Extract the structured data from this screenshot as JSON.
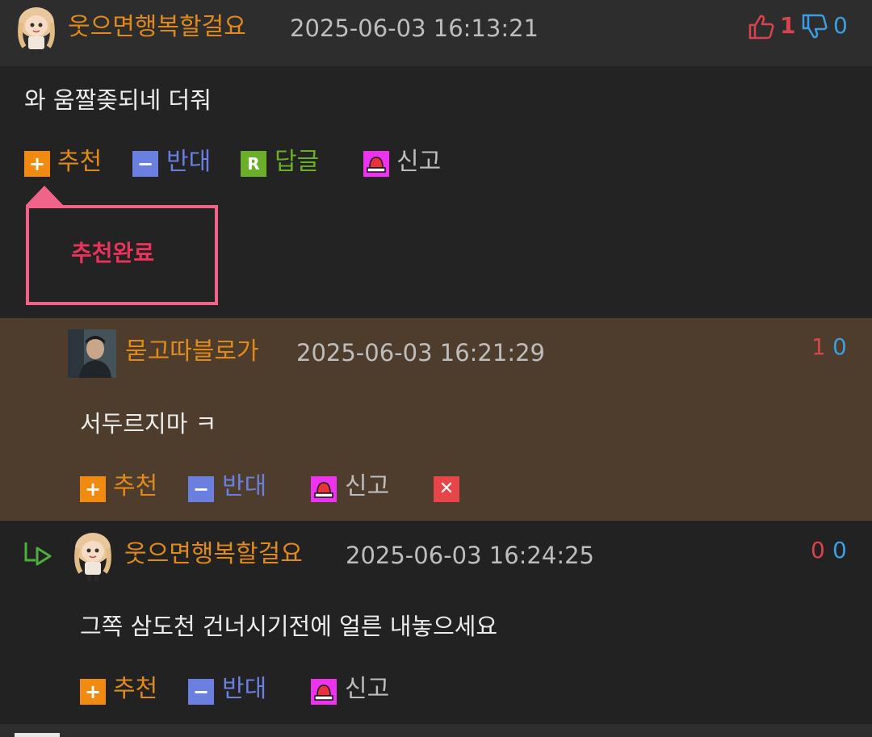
{
  "main_comment": {
    "nickname": "웃으면행복할걸요",
    "datetime": "2025-06-03 16:13:21",
    "like_count": "1",
    "dislike_count": "0",
    "content": "와 움짤좆되네 더줘",
    "actions": {
      "recommend": "추천",
      "oppose": "반대",
      "reply": "답글",
      "report": "신고",
      "reply_icon_letter": "R"
    },
    "popup_text": "추천완료"
  },
  "replies": [
    {
      "nickname": "묻고따블로가",
      "datetime": "2025-06-03 16:21:29",
      "like_count": "1",
      "dislike_count": "0",
      "content": "서두르지마 ㅋ",
      "actions": {
        "recommend": "추천",
        "oppose": "반대",
        "report": "신고"
      }
    },
    {
      "nickname": "웃으면행복할걸요",
      "datetime": "2025-06-03 16:24:25",
      "like_count": "0",
      "dislike_count": "0",
      "content": "그쪽 삼도천 건너시기전에 얼른 내놓으세요",
      "actions": {
        "recommend": "추천",
        "oppose": "반대",
        "report": "신고"
      }
    }
  ],
  "colors": {
    "nickname": "#e08a1c",
    "recommend": "#f08a10",
    "oppose": "#6a7fe0",
    "reply": "#6aae2a",
    "report_icon": "#ee33ee",
    "like": "#d9434d",
    "dislike": "#3a9ee0",
    "popup_border": "#f0648a",
    "reply_bg": "#4e3d2c"
  },
  "icons": [
    "avatar-cartoon-girl",
    "avatar-man-photo",
    "thumbs-up-icon",
    "thumbs-down-icon",
    "plus-icon",
    "minus-icon",
    "reply-r-icon",
    "siren-icon",
    "close-x-icon",
    "reply-arrow-icon"
  ]
}
